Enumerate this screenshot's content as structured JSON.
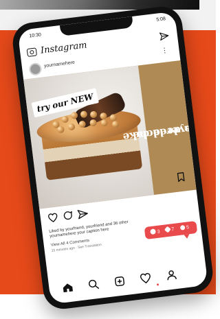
{
  "status": {
    "time": "10:30",
    "right": "5:08"
  },
  "app": {
    "title": "Instagram"
  },
  "post": {
    "username": "yournamehere",
    "promo_label": "try our NEW",
    "vertical_caption_line1": "dulce de leche",
    "vertical_caption_line2": "layered cake",
    "likes_text": "Liked by yourfriend, yourfriend and 36 other",
    "caption_text": "yournamehere your caption here",
    "comments_text": "View All 4 Comments",
    "timestamp_text": "15 minutes ago · See Translation"
  },
  "notifications": {
    "comments": "3",
    "likes": "7",
    "follows": "5"
  },
  "colors": {
    "background": "#e74a1a",
    "accent": "#e94b4d"
  },
  "icons": {
    "camera": "camera-icon",
    "direct": "send-icon",
    "heart": "heart-icon",
    "comment": "comment-icon",
    "share": "share-icon",
    "bookmark": "bookmark-icon",
    "home": "home-icon",
    "search": "search-icon",
    "add": "add-post-icon",
    "activity": "heart-icon",
    "profile": "profile-icon"
  }
}
